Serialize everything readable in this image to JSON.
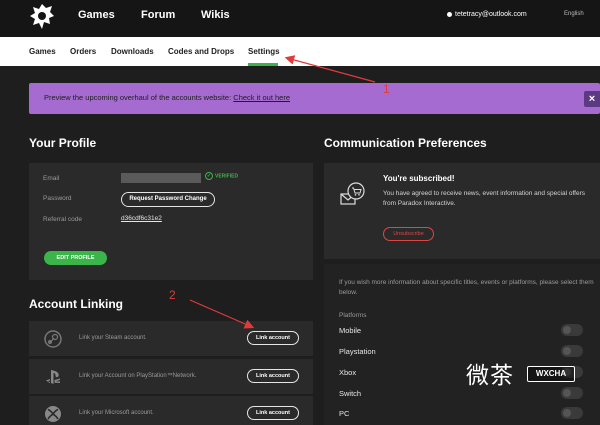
{
  "header": {
    "nav": [
      "Games",
      "Forum",
      "Wikis"
    ],
    "email": "tetetracy@outlook.com",
    "language": "English"
  },
  "subnav": {
    "items": [
      "Games",
      "Orders",
      "Downloads",
      "Codes and Drops",
      "Settings"
    ],
    "active": "Settings"
  },
  "banner": {
    "text": "Preview the upcoming overhaul of the accounts website:",
    "link": "Check it out here",
    "close": "×"
  },
  "profile": {
    "title": "Your Profile",
    "email_label": "Email",
    "verified": "VERIFIED",
    "password_label": "Password",
    "password_button": "Request Password Change",
    "referral_label": "Referral code",
    "referral_code": "d36cdf6c31e2",
    "edit_button": "EDIT PROFILE"
  },
  "account_linking": {
    "title": "Account Linking",
    "rows": [
      {
        "icon": "steam-icon",
        "text": "Link your Steam account.",
        "button": "Link account"
      },
      {
        "icon": "playstation-icon",
        "text": "Link your Account on PlayStation™Network.",
        "button": "Link account"
      },
      {
        "icon": "xbox-icon",
        "text": "Link your Microsoft account.",
        "button": "Link account"
      }
    ]
  },
  "communication": {
    "title": "Communication Preferences",
    "subscribed_title": "You're subscribed!",
    "subscribed_text": "You have agreed to receive news, event information and special offers from Paradox Interactive.",
    "unsubscribe": "Unsubscribe",
    "more_info": "If you wish more information about specific titles, events or platforms, please select them below.",
    "platforms_label": "Platforms",
    "platforms": [
      "Mobile",
      "Playstation",
      "Xbox",
      "Switch",
      "PC"
    ]
  },
  "annotations": [
    "1",
    "2"
  ],
  "watermark": {
    "text": "微茶",
    "badge": "WXCHA"
  },
  "colors": {
    "accent": "#3bb54a",
    "banner": "#a56bd1",
    "danger": "#e04545",
    "annotation": "#e03a3a"
  }
}
